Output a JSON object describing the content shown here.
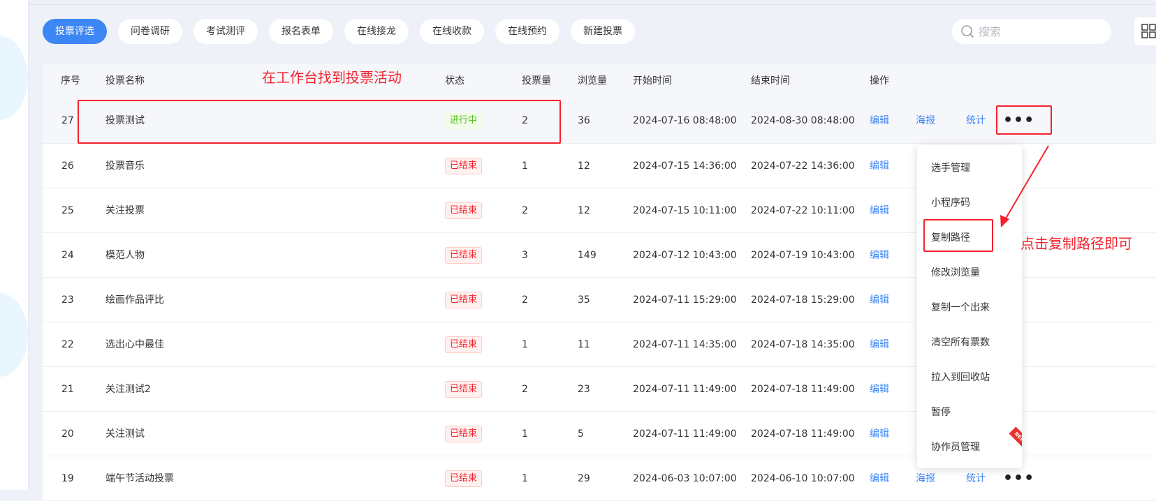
{
  "tabs": [
    "投票评选",
    "问卷调研",
    "考试测评",
    "报名表单",
    "在线接龙",
    "在线收款",
    "在线预约",
    "新建投票"
  ],
  "search": {
    "placeholder": "搜索"
  },
  "columns": {
    "id": "序号",
    "name": "投票名称",
    "status": "状态",
    "votes": "投票量",
    "views": "浏览量",
    "start": "开始时间",
    "end": "结束时间",
    "ops": "操作"
  },
  "actions": {
    "edit": "编辑",
    "poster": "海报",
    "stats": "统计"
  },
  "rows": [
    {
      "id": "27",
      "name": "投票测试",
      "status": "进行中",
      "votes": "2",
      "views": "36",
      "start": "2024-07-16 08:48:00",
      "end": "2024-08-30 08:48:00"
    },
    {
      "id": "26",
      "name": "投票音乐",
      "status": "已结束",
      "votes": "1",
      "views": "12",
      "start": "2024-07-15 14:36:00",
      "end": "2024-07-22 14:36:00"
    },
    {
      "id": "25",
      "name": "关注投票",
      "status": "已结束",
      "votes": "2",
      "views": "12",
      "start": "2024-07-15 10:11:00",
      "end": "2024-07-22 10:11:00"
    },
    {
      "id": "24",
      "name": "模范人物",
      "status": "已结束",
      "votes": "3",
      "views": "149",
      "start": "2024-07-12 10:43:00",
      "end": "2024-07-19 10:43:00"
    },
    {
      "id": "23",
      "name": "绘画作品评比",
      "status": "已结束",
      "votes": "2",
      "views": "35",
      "start": "2024-07-11 15:29:00",
      "end": "2024-07-18 15:29:00"
    },
    {
      "id": "22",
      "name": "选出心中最佳",
      "status": "已结束",
      "votes": "1",
      "views": "11",
      "start": "2024-07-11 14:35:00",
      "end": "2024-07-18 14:35:00"
    },
    {
      "id": "21",
      "name": "关注测试2",
      "status": "已结束",
      "votes": "2",
      "views": "23",
      "start": "2024-07-11 11:49:00",
      "end": "2024-07-18 11:49:00"
    },
    {
      "id": "20",
      "name": "关注测试",
      "status": "已结束",
      "votes": "1",
      "views": "5",
      "start": "2024-07-11 11:49:00",
      "end": "2024-07-18 11:49:00"
    },
    {
      "id": "19",
      "name": "端午节活动投票",
      "status": "已结束",
      "votes": "1",
      "views": "29",
      "start": "2024-06-03 10:07:00",
      "end": "2024-06-10 10:07:00"
    }
  ],
  "more_menu": [
    "选手管理",
    "小程序码",
    "复制路径",
    "修改浏览量",
    "复制一个出来",
    "清空所有票数",
    "拉入到回收站",
    "暂停",
    "协作员管理"
  ],
  "new_ribbon": "NEW",
  "annotations": {
    "find": "在工作台找到投票活动",
    "copy": "点击复制路径即可"
  },
  "colors": {
    "primary": "#3d86f5",
    "annotation": "#f5222d",
    "ongoing": "#52c41a",
    "ended": "#f5222d"
  }
}
